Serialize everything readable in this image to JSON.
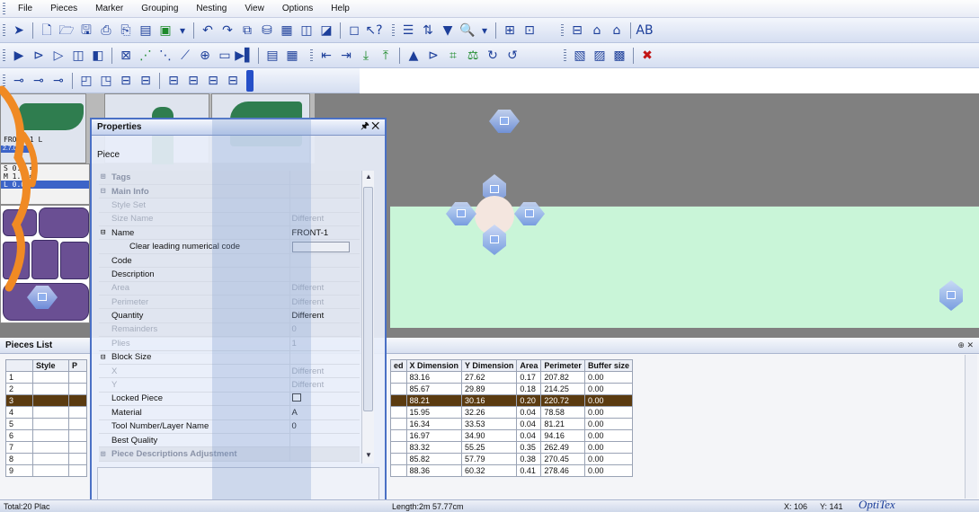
{
  "menu": [
    "File",
    "Pieces",
    "Marker",
    "Grouping",
    "Nesting",
    "View",
    "Options",
    "Help"
  ],
  "toolbar1": {
    "icons": [
      "pointer-icon",
      "new-document-icon",
      "open-folder-icon",
      "save-icon",
      "print-preview-icon",
      "print-icon",
      "plotter-icon",
      "screen-icon",
      "undo-icon",
      "redo-icon",
      "copy-icon",
      "find-icon",
      "layout-icon",
      "piece-icon",
      "piece-list-icon",
      "window-icon",
      "help-icon"
    ],
    "icons_b": [
      "align-icon",
      "flip-icon",
      "filter-icon",
      "zoom-icon",
      "zoom-extra-icon",
      "grid-icon"
    ],
    "icons_c": [
      "table-icon",
      "pieces-icon",
      "split-icon",
      "labels-icon"
    ]
  },
  "toolbar2": {
    "icons": [
      "play-icon",
      "stop-icon",
      "step-icon",
      "run-icon",
      "batch-icon",
      "nest-icon",
      "graph-icon",
      "measure-icon",
      "lines-icon",
      "zoom-in-icon",
      "frame-icon",
      "flag-icon",
      "box-icon",
      "calc-icon"
    ],
    "icons_b": [
      "move-left-icon",
      "move-right-icon",
      "move-down-icon",
      "move-up-icon",
      "move-up-triangle-icon",
      "pin-icon",
      "ladder-icon",
      "balance-icon",
      "refresh-icon",
      "rotate-icon"
    ],
    "icons_c": [
      "chart-icon",
      "report-icon",
      "stats-icon",
      "close-red-icon"
    ]
  },
  "toolbar3": {
    "icons": [
      "align-left-icon",
      "align-right-icon",
      "align-center-icon",
      "layer-a-icon",
      "layer-b-icon",
      "layer-c-icon",
      "layer-d-icon",
      "layer-e-icon",
      "layer-f-icon",
      "layer-g-icon",
      "layer-h-icon"
    ]
  },
  "thumbs": {
    "label": "FRONT-1 L",
    "code": "2.7.0"
  },
  "sizes": [
    {
      "text": "S 0.0 ⇆",
      "sel": false
    },
    {
      "text": "M 1.1 ⇆",
      "sel": false
    },
    {
      "text": "L 0.0 ⇆",
      "sel": true
    }
  ],
  "properties": {
    "title": "Properties",
    "pin": "🖈 ✕",
    "subtitle": "Piece",
    "rows": [
      {
        "exp": "⊞",
        "k": "Tags",
        "v": "",
        "type": "cat"
      },
      {
        "exp": "⊟",
        "k": "Main Info",
        "v": "",
        "type": "cat"
      },
      {
        "exp": "",
        "k": "Style Set",
        "v": "",
        "type": "dis"
      },
      {
        "exp": "",
        "k": "Size Name",
        "v": "Different",
        "type": "dis"
      },
      {
        "exp": "⊟",
        "k": "Name",
        "v": "FRONT-1",
        "type": "norm"
      },
      {
        "exp": "",
        "k": "Clear leading numerical code",
        "v": "",
        "type": "btn"
      },
      {
        "exp": "",
        "k": "Code",
        "v": "",
        "type": "norm"
      },
      {
        "exp": "",
        "k": "Description",
        "v": "",
        "type": "norm"
      },
      {
        "exp": "",
        "k": "Area",
        "v": "Different",
        "type": "dis"
      },
      {
        "exp": "",
        "k": "Perimeter",
        "v": "Different",
        "type": "dis"
      },
      {
        "exp": "",
        "k": "Quantity",
        "v": "Different",
        "type": "norm"
      },
      {
        "exp": "",
        "k": "Remainders",
        "v": "0",
        "type": "dis"
      },
      {
        "exp": "",
        "k": "Plies",
        "v": "1",
        "type": "dis"
      },
      {
        "exp": "⊟",
        "k": "Block Size",
        "v": "",
        "type": "norm"
      },
      {
        "exp": "",
        "k": "X",
        "v": "Different",
        "type": "dis"
      },
      {
        "exp": "",
        "k": "Y",
        "v": "Different",
        "type": "dis"
      },
      {
        "exp": "",
        "k": "Locked Piece",
        "v": "",
        "type": "chk"
      },
      {
        "exp": "",
        "k": "Material",
        "v": "A",
        "type": "norm"
      },
      {
        "exp": "",
        "k": "Tool Number/Layer Name",
        "v": "0",
        "type": "norm"
      },
      {
        "exp": "",
        "k": "Best Quality",
        "v": "",
        "type": "norm"
      },
      {
        "exp": "⊞",
        "k": "Piece Descriptions Adjustment",
        "v": "",
        "type": "cat"
      }
    ]
  },
  "pieces_list": {
    "title": "Pieces List",
    "pin": "⊕ ✕",
    "left_headers": [
      "Style",
      "P"
    ],
    "row_numbers": [
      "1",
      "2",
      "3",
      "4",
      "5",
      "6",
      "7",
      "8",
      "9"
    ],
    "headers": [
      "ed",
      "X Dimension",
      "Y Dimension",
      "Area",
      "Perimeter",
      "Buffer size"
    ],
    "rows": [
      [
        "",
        "83.16",
        "27.62",
        "0.17",
        "207.82",
        "0.00"
      ],
      [
        "",
        "85.67",
        "29.89",
        "0.18",
        "214.25",
        "0.00"
      ],
      [
        "",
        "88.21",
        "30.16",
        "0.20",
        "220.72",
        "0.00"
      ],
      [
        "",
        "15.95",
        "32.26",
        "0.04",
        "78.58",
        "0.00"
      ],
      [
        "",
        "16.34",
        "33.53",
        "0.04",
        "81.21",
        "0.00"
      ],
      [
        "",
        "16.97",
        "34.90",
        "0.04",
        "94.16",
        "0.00"
      ],
      [
        "",
        "83.32",
        "55.25",
        "0.35",
        "262.49",
        "0.00"
      ],
      [
        "",
        "85.82",
        "57.79",
        "0.38",
        "270.45",
        "0.00"
      ],
      [
        "",
        "88.36",
        "60.32",
        "0.41",
        "278.46",
        "0.00"
      ]
    ],
    "highlight_row": 2
  },
  "status": {
    "left": "Total:20 Plac",
    "length": "Length:2m 57.77cm",
    "x": "X: 106",
    "y": "Y: 141",
    "logo": "OptiTex"
  },
  "colors": {
    "accent": "#254fc8",
    "marker_bg": "#c9f5d8",
    "workarea": "#808080",
    "highlight": "#5b3b10"
  }
}
